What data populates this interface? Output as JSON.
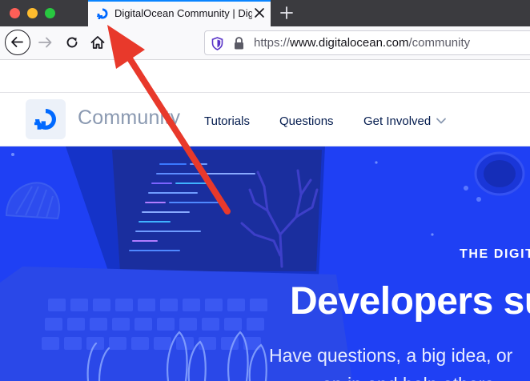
{
  "browser": {
    "tab": {
      "title": "DigitalOcean Community | DigitalOcean"
    },
    "address_bar": {
      "url_scheme": "https://",
      "url_host": "www.digitalocean.com",
      "url_path": "/community"
    }
  },
  "site": {
    "brand": "Community",
    "nav": {
      "tutorials": "Tutorials",
      "questions": "Questions",
      "get_involved": "Get Involved"
    }
  },
  "hero": {
    "eyebrow": "THE DIGITALOCEAN COMMUNITY",
    "headline": "Developers supporting developers",
    "subhead": "Have questions, a big idea, or",
    "subhead2": "on in and help others."
  },
  "colors": {
    "hero_bg": "#1f40f4",
    "brand_blue": "#0069ff",
    "annotation_arrow": "#e8392b",
    "tab_accent": "#0a84ff"
  },
  "icons": {
    "back": "arrow-left-icon",
    "forward": "arrow-right-icon",
    "reload": "reload-icon",
    "home": "home-icon",
    "tracking": "shield-icon",
    "secure": "lock-icon",
    "close_tab": "close-icon",
    "new_tab": "plus-icon",
    "dropdown": "chevron-down-icon"
  }
}
